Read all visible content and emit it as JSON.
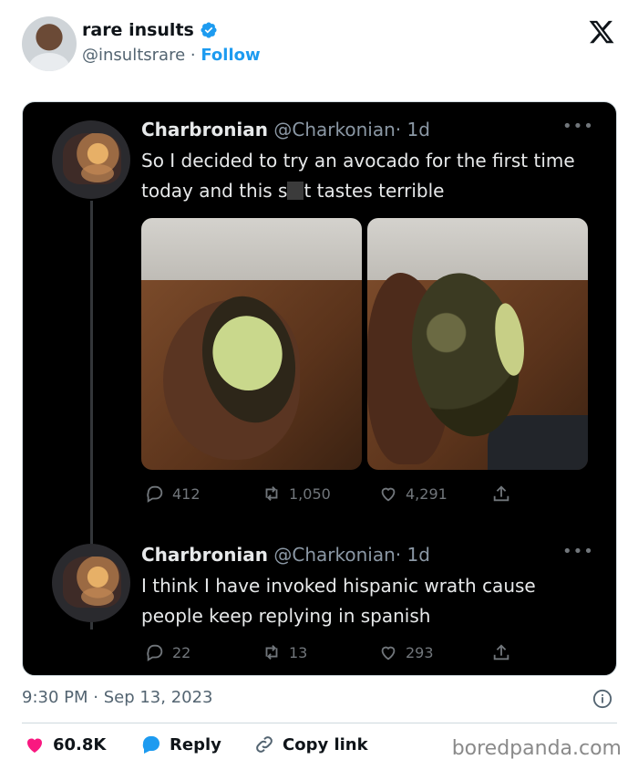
{
  "tweet": {
    "author_name": "rare insults",
    "author_handle": "@insultsrare",
    "separator": "·",
    "follow_label": "Follow",
    "timestamp": "9:30 PM · Sep 13, 2023",
    "likes": "60.8K",
    "reply_label": "Reply",
    "copy_link_label": "Copy link"
  },
  "embedded": {
    "posts": [
      {
        "name": "Charbronian",
        "handle": "@Charkonian",
        "age": "· 1d",
        "text_part1": "So I decided to try an avocado for the first time today and this s",
        "text_part2": "t tastes terrible",
        "replies": "412",
        "retweets": "1,050",
        "likes": "4,291"
      },
      {
        "name": "Charbronian",
        "handle": "@Charkonian",
        "age": "· 1d",
        "text": "I think I have invoked hispanic wrath cause people keep replying in spanish",
        "replies": "22",
        "retweets": "13",
        "likes": "293"
      }
    ],
    "more_dots": "•••"
  },
  "watermark": "boredpanda.com",
  "colors": {
    "accent": "#1d9bf0",
    "like": "#f91880"
  }
}
